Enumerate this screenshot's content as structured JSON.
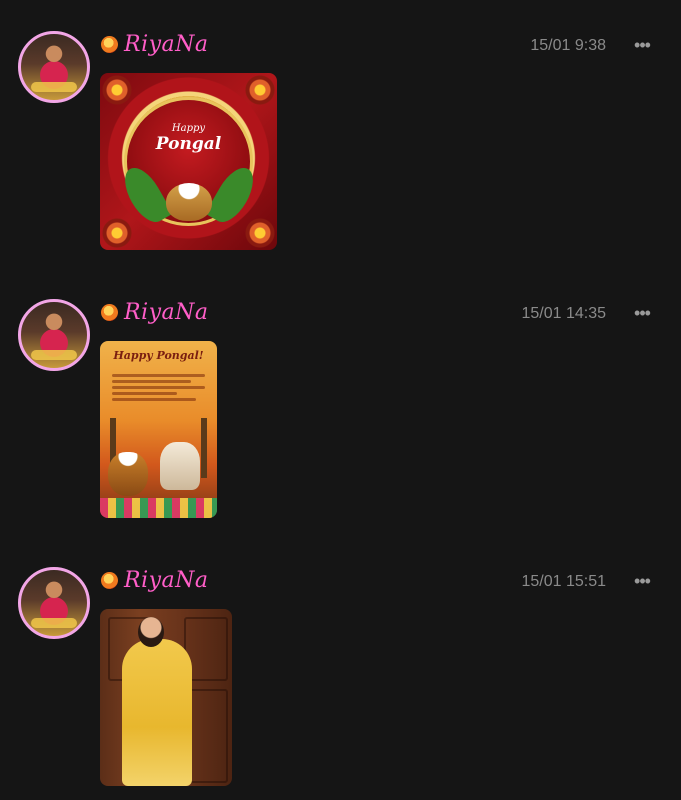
{
  "posts": [
    {
      "username": "RiyaNa",
      "time": "15/01 9:38",
      "more": "•••",
      "image": {
        "heading_small": "Happy",
        "heading_large": "Pongal"
      }
    },
    {
      "username": "RiyaNa",
      "time": "15/01 14:35",
      "more": "•••",
      "image": {
        "heading": "Happy Pongal!"
      }
    },
    {
      "username": "RiyaNa",
      "time": "15/01 15:51",
      "more": "•••",
      "image": {}
    }
  ]
}
